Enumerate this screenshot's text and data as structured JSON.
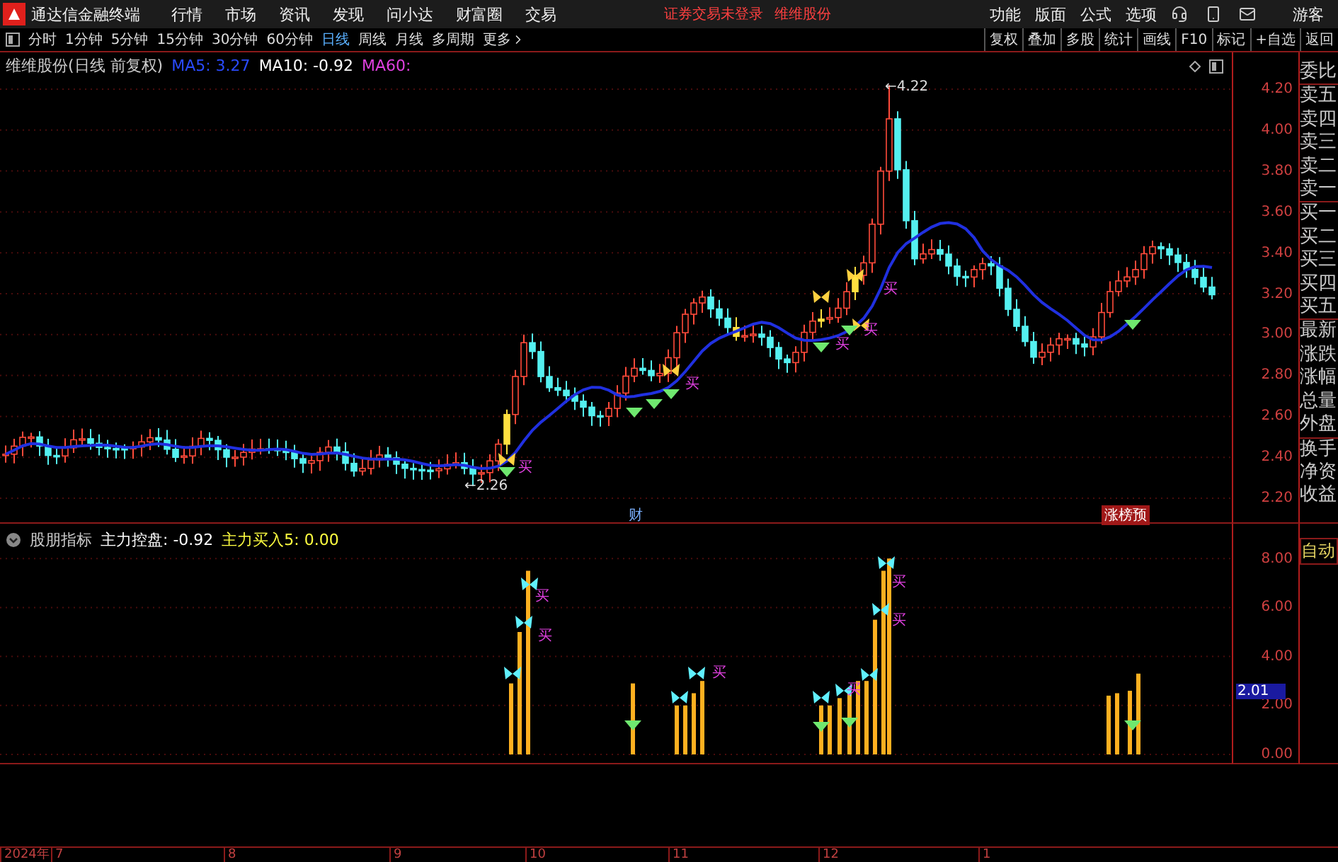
{
  "menu_bar": {
    "app_title": "通达信金融终端",
    "menus": [
      "行情",
      "市场",
      "资讯",
      "发现",
      "问小达",
      "财富圈",
      "交易"
    ],
    "notice": "证券交易未登录",
    "stock": "维维股份",
    "right_menus": [
      "功能",
      "版面",
      "公式",
      "选项"
    ],
    "user": "游客"
  },
  "period_tabs": [
    {
      "label": "分时",
      "selected": false
    },
    {
      "label": "1分钟",
      "selected": false
    },
    {
      "label": "5分钟",
      "selected": false
    },
    {
      "label": "15分钟",
      "selected": false
    },
    {
      "label": "30分钟",
      "selected": false
    },
    {
      "label": "60分钟",
      "selected": false
    },
    {
      "label": "日线",
      "selected": true
    },
    {
      "label": "周线",
      "selected": false
    },
    {
      "label": "月线",
      "selected": false
    },
    {
      "label": "多周期",
      "selected": false
    },
    {
      "label": "更多",
      "selected": false
    }
  ],
  "tool_buttons": [
    "复权",
    "叠加",
    "多股",
    "统计",
    "画线",
    "F10",
    "标记",
    "+自选",
    "返回"
  ],
  "main_chart": {
    "title": "维维股份(日线 前复权)",
    "ma": [
      {
        "label": "MA5: 3.27",
        "color": "#2a4bff"
      },
      {
        "label": "MA10: -0.92",
        "color": "#ffffff"
      },
      {
        "label": "MA60:",
        "color": "#e040e0"
      }
    ],
    "high_label": "←4.22",
    "low_label": "←2.26",
    "price_ticks": [
      "4.20",
      "4.00",
      "3.80",
      "3.60",
      "3.40",
      "3.20",
      "3.00",
      "2.80",
      "2.60",
      "2.40",
      "2.20"
    ],
    "buy_marks": [
      "买",
      "买",
      "买",
      "买",
      "买"
    ],
    "event_marks": [
      {
        "label": "财",
        "kind": "plain"
      },
      {
        "label": "涨榜预",
        "kind": "boxed"
      }
    ]
  },
  "indicator": {
    "name": "股朋指标",
    "values": [
      {
        "label": "主力控盘: -0.92",
        "color": "#ffffff"
      },
      {
        "label": "主力买入5: 0.00",
        "color": "#ffff40"
      }
    ],
    "ticks": [
      "8.00",
      "6.00",
      "4.00",
      "2.00",
      "0.00"
    ],
    "cursor_value": "2.01",
    "buy_marks": [
      "买",
      "买",
      "买",
      "买",
      "买",
      "买"
    ]
  },
  "quote_sidebar": {
    "items": [
      "委比",
      "卖五",
      "卖四",
      "卖三",
      "卖二",
      "卖一",
      "买一",
      "买二",
      "买三",
      "买四",
      "买五",
      "最新",
      "涨跌",
      "涨幅",
      "总量",
      "外盘",
      "换手",
      "净资",
      "收益"
    ],
    "auto_button": "自动"
  },
  "date_axis": [
    "2024年",
    "7",
    "8",
    "9",
    "10",
    "11",
    "12",
    "1"
  ]
}
